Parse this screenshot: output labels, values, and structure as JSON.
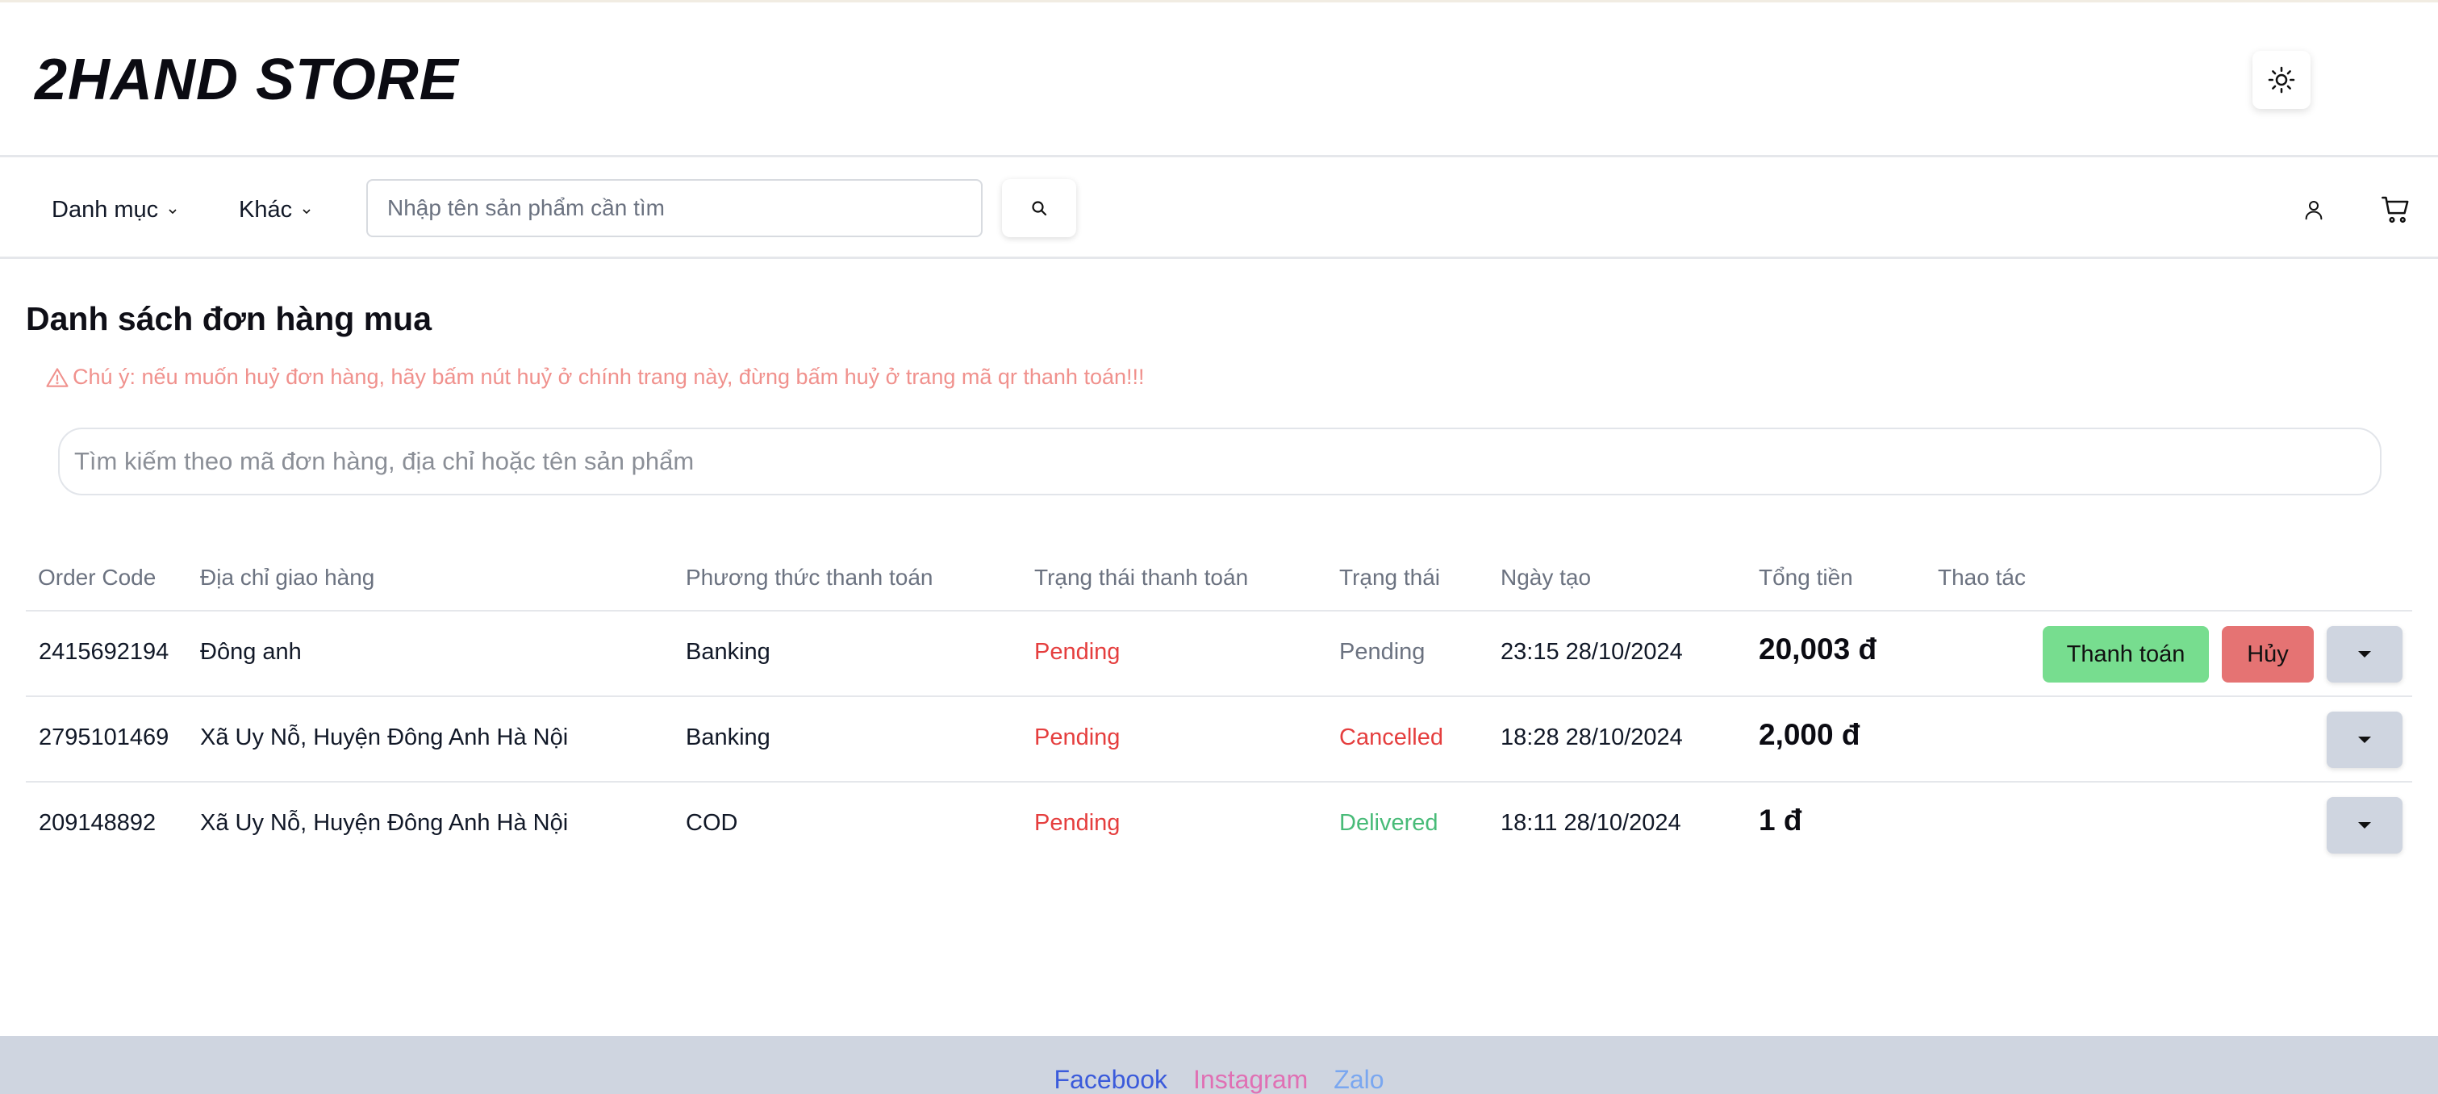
{
  "header": {
    "logo": "2HAND STORE",
    "theme_icon": "sun-icon"
  },
  "nav": {
    "categories_label": "Danh mục",
    "other_label": "Khác",
    "search_placeholder": "Nhập tên sản phẩm cần tìm",
    "search_icon": "search-icon",
    "user_icon": "user-icon",
    "cart_icon": "cart-icon"
  },
  "main": {
    "title": "Danh sách đơn hàng mua",
    "warning": "Chú ý: nếu muốn huỷ đơn hàng, hãy bấm nút huỷ ở chính trang này, đừng bấm huỷ ở trang mã qr thanh toán!!!",
    "search_placeholder": "Tìm kiếm theo mã đơn hàng, địa chỉ hoặc tên sản phẩm"
  },
  "table": {
    "headers": [
      "Order Code",
      "Địa chỉ giao hàng",
      "Phương thức thanh toán",
      "Trạng thái thanh toán",
      "Trạng thái",
      "Ngày tạo",
      "Tổng tiền",
      "Thao tác"
    ],
    "rows": [
      {
        "code": "2415692194",
        "address": "Đông anh",
        "method": "Banking",
        "payment_status": "Pending",
        "status": "Pending",
        "created": "23:15 28/10/2024",
        "total": "20,003 đ",
        "pay_label": "Thanh toán",
        "cancel_label": "Hủy"
      },
      {
        "code": "2795101469",
        "address": "Xã Uy Nỗ, Huyện Đông Anh Hà Nội",
        "method": "Banking",
        "payment_status": "Pending",
        "status": "Cancelled",
        "created": "18:28 28/10/2024",
        "total": "2,000 đ"
      },
      {
        "code": "209148892",
        "address": "Xã Uy Nỗ, Huyện Đông Anh Hà Nội",
        "method": "COD",
        "payment_status": "Pending",
        "status": "Delivered",
        "created": "18:11 28/10/2024",
        "total": "1 đ"
      }
    ]
  },
  "colors": {
    "status_pending": "#6b7280",
    "status_cancelled": "#e53e3e",
    "status_delivered": "#48bb78",
    "payment_pending": "#e53e3e",
    "warning": "#f0918d",
    "pay_button": "#77dd8f",
    "cancel_button": "#e57373",
    "toggle_button": "#cfd5e0",
    "facebook": "#3b5bdb",
    "instagram": "#e070b4",
    "zalo": "#7aa7f0"
  },
  "footer": {
    "links": [
      "Facebook",
      "Instagram",
      "Zalo"
    ]
  }
}
